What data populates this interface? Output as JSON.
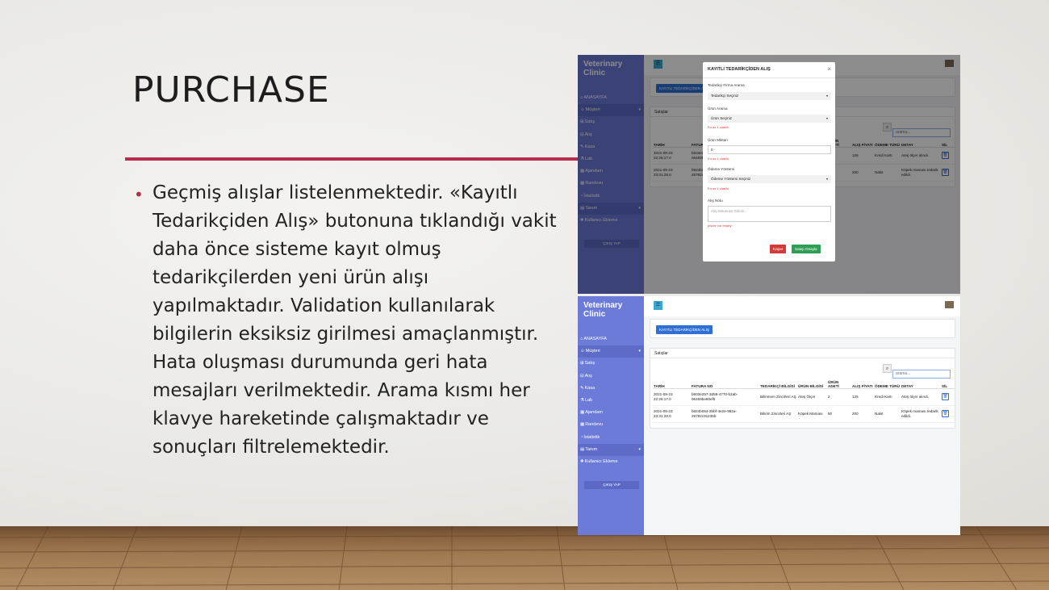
{
  "slide": {
    "title": "PURCHASE",
    "bullet": "Geçmiş alışlar listelenmektedir. «Kayıtlı Tedarikçiden Alış» butonuna tıklandığı vakit daha önce sisteme kayıt olmuş tedarikçilerden yeni ürün alışı yapılmaktadır. Validation kullanılarak bilgilerin eksiksiz girilmesi amaçlanmıştır. Hata oluşması durumunda geri hata mesajları verilmektedir. Arama kısmı her klavye hareketinde çalışmaktadır ve sonuçları filtrelemektedir."
  },
  "colors": {
    "accent": "#b72b4c",
    "sidebar": "#6c7ad8",
    "primary": "#2f6fd6"
  },
  "app": {
    "brand": "Veterinary Clinic",
    "nav": [
      {
        "icon": "home-icon",
        "label": "ANASAYFA"
      },
      {
        "icon": "users-icon",
        "label": "Müşteri",
        "expand": "▾"
      },
      {
        "icon": "cart-icon",
        "label": "Satış"
      },
      {
        "icon": "basket-icon",
        "label": "Alış"
      },
      {
        "icon": "cash-icon",
        "label": "Kasa"
      },
      {
        "icon": "flask-icon",
        "label": "Lab"
      },
      {
        "icon": "calendar-icon",
        "label": "Ajandam"
      },
      {
        "icon": "calendar-icon",
        "label": "Randevu"
      },
      {
        "icon": "chart-icon",
        "label": "İstatistik"
      },
      {
        "icon": "grid-icon",
        "label": "Tanım",
        "expand": "▾"
      },
      {
        "icon": "user-plus-icon",
        "label": "Kullanıcı Ekleme"
      }
    ],
    "logout": "ÇIKIŞ YAP",
    "purchase_button": "KAYITLI TEDARİKÇİDEN ALIŞ",
    "card_title": "Satışlar",
    "search_placeholder": "arama...",
    "columns": [
      "TARİH",
      "FATURA NO",
      "TEDARİKÇİ BİLGİSİ",
      "ÜRÜN BİLGİSİ",
      "ÜRÜN ADETİ",
      "ALIŞ FİYATI",
      "ÖDEME TÜRÜ",
      "DETAY",
      "SİL"
    ],
    "rows": [
      [
        "2021-09-23 22:26:17.0",
        "b503e257-3d59-4770-b2ab-06469be80ef5",
        "Bilinmem Zincirleri AŞ",
        "Ateş Ölçer",
        "2",
        "125",
        "Kredi Kartı",
        "Ateş ölçer alındı."
      ],
      [
        "2021-09-23 23:31:28.0",
        "b924b064-2bbf-4e2e-982a-26782c91236b",
        "Bilirim Zincirleri AŞ",
        "Köpek Maması",
        "50",
        "200",
        "Nakit",
        "Köpek maması tedarik edildi."
      ]
    ]
  },
  "modal": {
    "title": "KAYITLI TEDARİKÇİDEN ALIŞ",
    "close": "×",
    "supplier_label": "Tedarikçi Firma Arama",
    "supplier_select": "Tedarikçi Seçiniz",
    "product_label": "Ürün Arama",
    "product_select": "Ürün Seçiniz",
    "err_min_one": "En az 1 olabilir",
    "qty_label": "Ürün Miktarı",
    "qty_value": "0",
    "payment_label": "Ödeme Yöntemi",
    "payment_select": "Ödeme Yöntemi Seçiniz",
    "note_label": "Alış Notu",
    "note_placeholder": "Alış Notunuzu Giriniz.",
    "note_error": "pNote not empty!",
    "cancel": "Kapat",
    "confirm": "Satışı Onayla"
  }
}
